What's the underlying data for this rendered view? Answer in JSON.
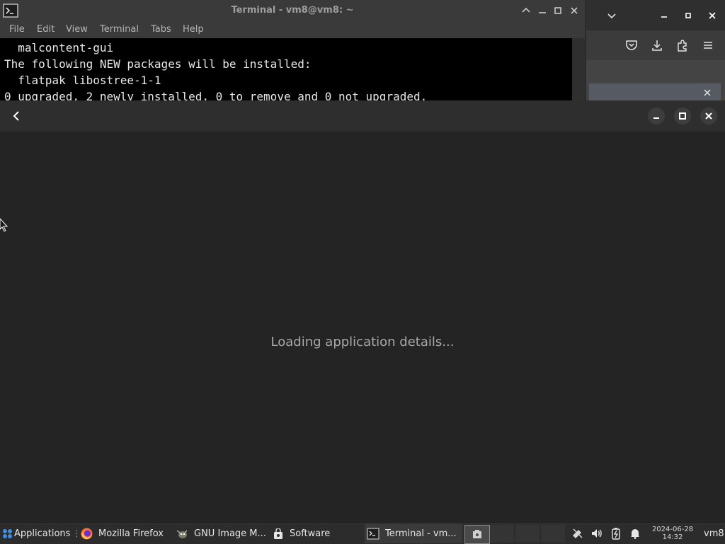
{
  "terminal": {
    "title": "Terminal - vm8@vm8: ~",
    "menu": [
      "File",
      "Edit",
      "View",
      "Terminal",
      "Tabs",
      "Help"
    ],
    "lines": [
      "  malcontent-gui",
      "The following NEW packages will be installed:",
      "  flatpak libostree-1-1",
      "0 upgraded, 2 newly installed, 0 to remove and 0 not upgraded."
    ]
  },
  "software": {
    "loading_text": "Loading application details..."
  },
  "taskbar": {
    "applications_label": "Applications",
    "items": [
      "Mozilla Firefox",
      "GNU Image M...",
      "Software",
      "Terminal - vm..."
    ],
    "clock_date": "2024-06-28",
    "clock_time": "14:32",
    "user": "vm8"
  },
  "colors": {
    "terminal_bg": "#000000",
    "window_bg": "#242424",
    "headerbar": "#2e2e2e",
    "taskbar": "#2c2c2c",
    "firefox_orange": "#ff7139",
    "accent_blue": "#3d8ee0"
  }
}
